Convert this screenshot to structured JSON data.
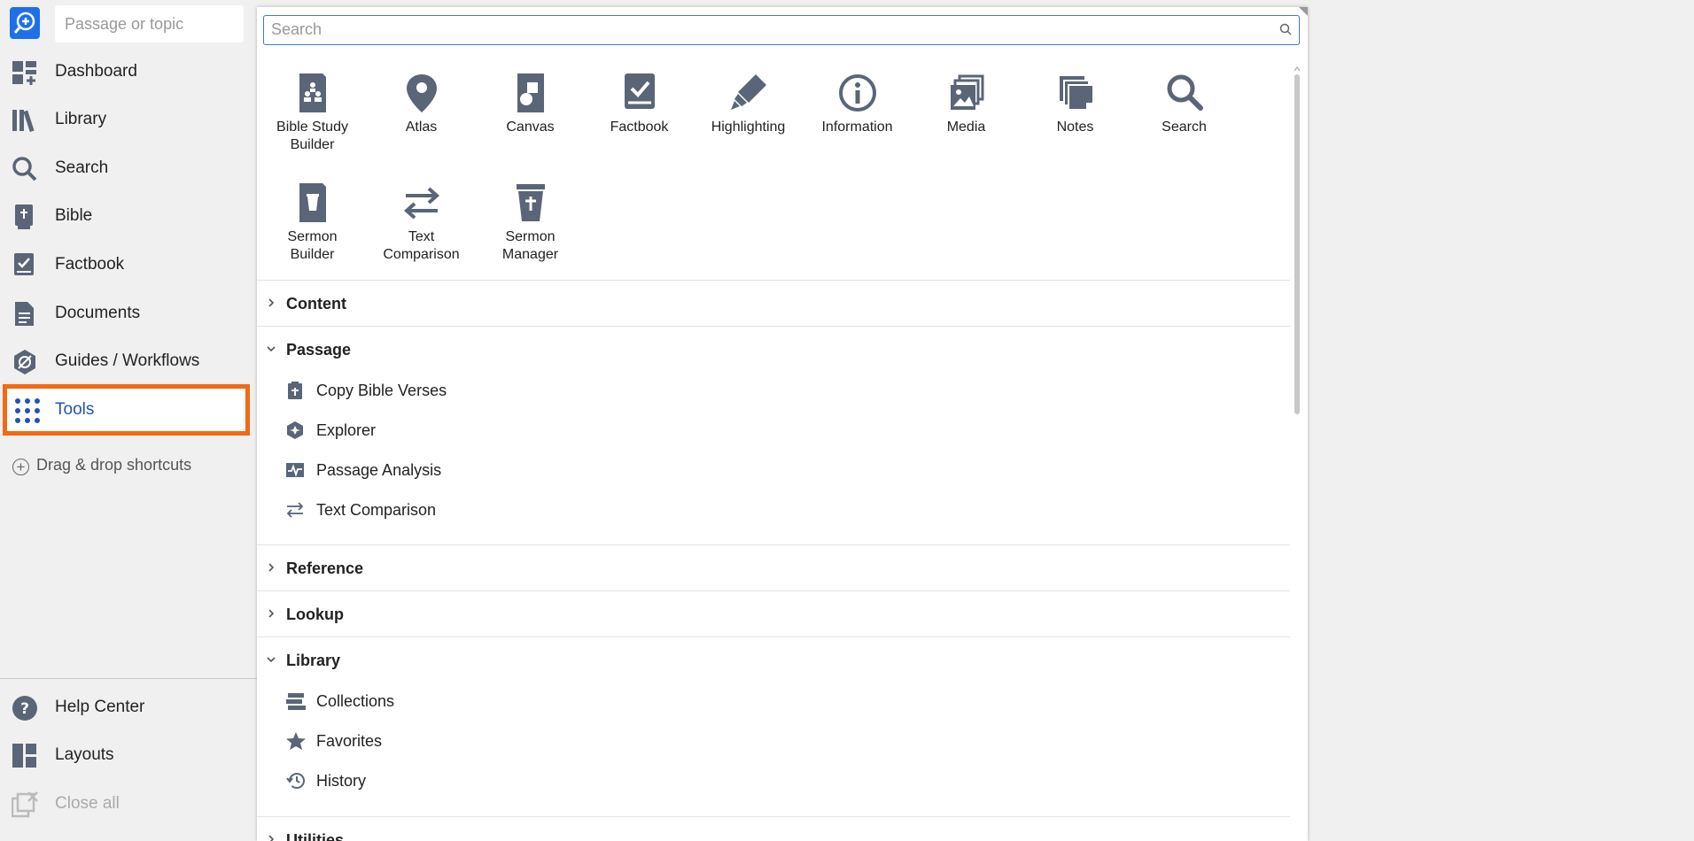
{
  "sidebar": {
    "passage_placeholder": "Passage or topic",
    "items": [
      {
        "label": "Dashboard",
        "icon": "dashboard-icon"
      },
      {
        "label": "Library",
        "icon": "library-icon"
      },
      {
        "label": "Search",
        "icon": "search-icon"
      },
      {
        "label": "Bible",
        "icon": "bible-icon"
      },
      {
        "label": "Factbook",
        "icon": "factbook-icon"
      },
      {
        "label": "Documents",
        "icon": "documents-icon"
      },
      {
        "label": "Guides / Workflows",
        "icon": "guides-icon"
      },
      {
        "label": "Tools",
        "icon": "tools-grid-icon"
      }
    ],
    "drag_drop": "Drag & drop shortcuts",
    "bottom_items": [
      {
        "label": "Help Center",
        "icon": "help-icon"
      },
      {
        "label": "Layouts",
        "icon": "layouts-icon"
      },
      {
        "label": "Close all",
        "icon": "close-all-icon"
      }
    ]
  },
  "tools_panel": {
    "search_placeholder": "Search",
    "tiles": [
      {
        "label": "Bible Study Builder",
        "icon": "bible-study-builder-icon"
      },
      {
        "label": "Atlas",
        "icon": "atlas-pin-icon"
      },
      {
        "label": "Canvas",
        "icon": "canvas-icon"
      },
      {
        "label": "Factbook",
        "icon": "factbook-icon"
      },
      {
        "label": "Highlighting",
        "icon": "highlighter-icon"
      },
      {
        "label": "Information",
        "icon": "information-icon"
      },
      {
        "label": "Media",
        "icon": "media-icon"
      },
      {
        "label": "Notes",
        "icon": "notes-icon"
      },
      {
        "label": "Search",
        "icon": "search-icon"
      },
      {
        "label": "Sermon Builder",
        "icon": "sermon-builder-icon"
      },
      {
        "label": "Text Comparison",
        "icon": "text-comparison-icon"
      },
      {
        "label": "Sermon Manager",
        "icon": "sermon-manager-icon"
      }
    ],
    "sections": [
      {
        "label": "Content",
        "expanded": false,
        "items": []
      },
      {
        "label": "Passage",
        "expanded": true,
        "items": [
          {
            "label": "Copy Bible Verses",
            "icon": "clipboard-icon"
          },
          {
            "label": "Explorer",
            "icon": "explorer-icon"
          },
          {
            "label": "Passage Analysis",
            "icon": "passage-analysis-icon"
          },
          {
            "label": "Text Comparison",
            "icon": "text-comparison-icon"
          }
        ]
      },
      {
        "label": "Reference",
        "expanded": false,
        "items": []
      },
      {
        "label": "Lookup",
        "expanded": false,
        "items": []
      },
      {
        "label": "Library",
        "expanded": true,
        "items": [
          {
            "label": "Collections",
            "icon": "collections-icon"
          },
          {
            "label": "Favorites",
            "icon": "star-icon"
          },
          {
            "label": "History",
            "icon": "history-icon"
          }
        ]
      },
      {
        "label": "Utilities",
        "expanded": false,
        "items": []
      }
    ]
  },
  "colors": {
    "accent": "#1f6fe8",
    "highlight_border": "#f26a14",
    "icon": "#5b6578"
  }
}
